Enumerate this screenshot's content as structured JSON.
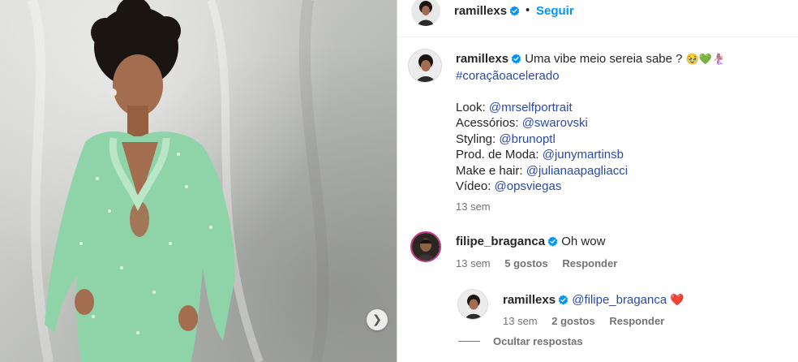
{
  "header": {
    "username": "ramillexs",
    "separator": "•",
    "follow_label": "Seguir"
  },
  "post": {
    "username": "ramillexs",
    "caption_text": "Uma vibe meio sereia sabe ?",
    "caption_emojis": "🥹💚🧜🏽‍♀️",
    "hashtag": "#coraçãoacelerado",
    "credits": [
      {
        "label": "Look:",
        "mention": "@mrselfportrait"
      },
      {
        "label": "Acessórios:",
        "mention": "@swarovski"
      },
      {
        "label": "Styling:",
        "mention": "@brunoptl"
      },
      {
        "label": "Prod. de Moda:",
        "mention": "@junymartinsb"
      },
      {
        "label": "Make e hair:",
        "mention": "@julianaapagliacci"
      },
      {
        "label": "Vídeo:",
        "mention": "@opsviegas"
      }
    ],
    "time": "13 sem"
  },
  "comments": [
    {
      "username": "filipe_braganca",
      "text": "Oh wow",
      "time": "13 sem",
      "likes": "5 gostos",
      "reply_label": "Responder"
    }
  ],
  "reply": {
    "username": "ramillexs",
    "mention": "@filipe_braganca",
    "emoji": "❤️",
    "time": "13 sem",
    "likes": "2 gostos",
    "reply_label": "Responder"
  },
  "hide_replies_label": "Ocultar respostas",
  "colors": {
    "accent": "#0095f6",
    "link": "#2b4aa8",
    "verified": "#0095f6",
    "meta": "#737373",
    "dress": "#8fd4a8"
  },
  "icons": {
    "next": "chevron-right-icon",
    "verified": "verified-badge-icon"
  }
}
